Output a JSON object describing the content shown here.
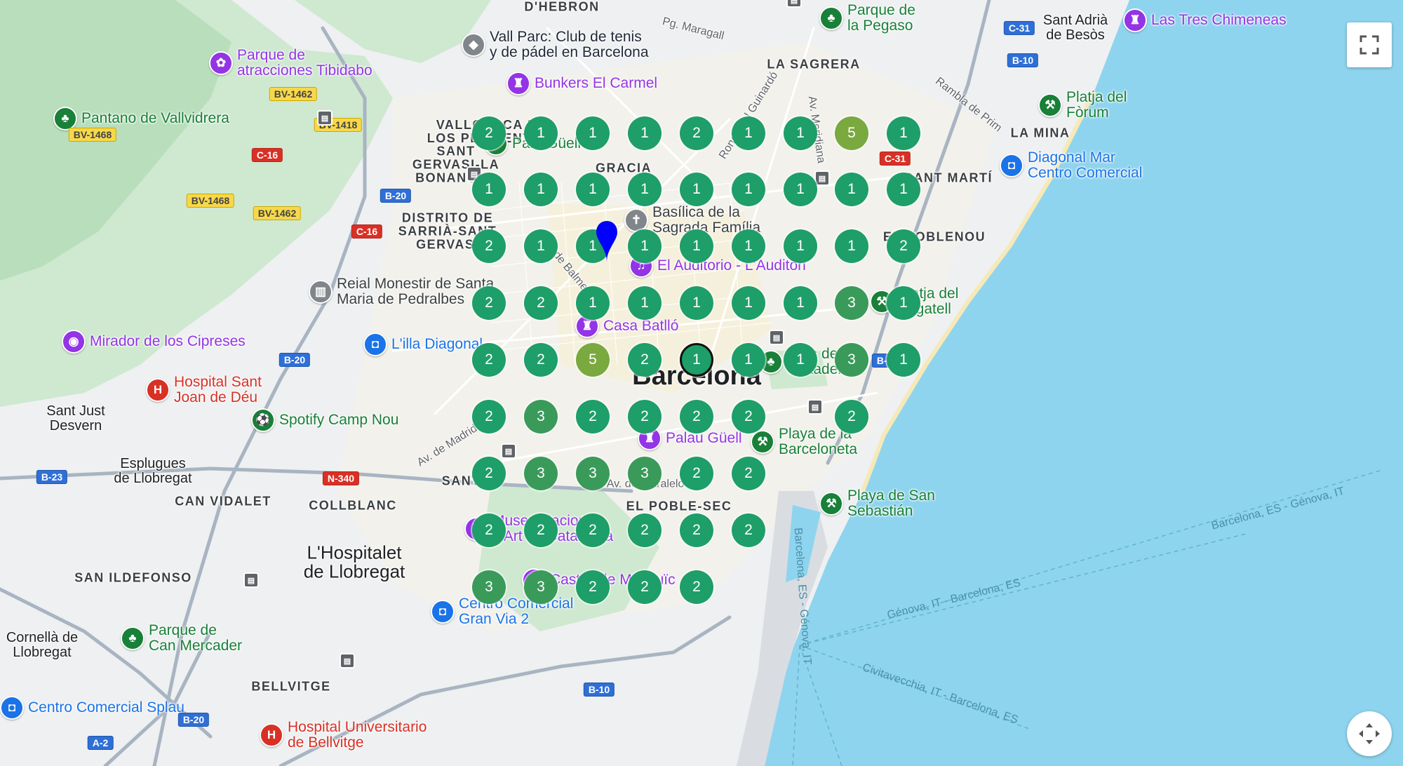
{
  "map": {
    "city_label": "Barcelona",
    "places": [
      {
        "id": "dhebron",
        "text": "D'HEBRON",
        "cls": "district"
      },
      {
        "id": "la-sagrera",
        "text": "LA SAGRERA",
        "cls": "district"
      },
      {
        "id": "la-mina",
        "text": "LA MINA",
        "cls": "district"
      },
      {
        "id": "gracia",
        "text": "GRACIA",
        "cls": "district"
      },
      {
        "id": "sant-marti",
        "text": "SANT MARTÍ",
        "cls": "district"
      },
      {
        "id": "sant-gervasi",
        "text": "SANT\nGERVASI-LA\nBONANOVA",
        "cls": "district"
      },
      {
        "id": "vallcarca",
        "text": "VALLCARCA I\nLOS PENITENTS",
        "cls": "district"
      },
      {
        "id": "sarria",
        "text": "DISTRITO DE\nSARRIÀ-SANT\nGERVASI",
        "cls": "district"
      },
      {
        "id": "el-poblenou",
        "text": "EL POBLENOU",
        "cls": "district"
      },
      {
        "id": "can-vidalet",
        "text": "CAN VIDALET",
        "cls": "district"
      },
      {
        "id": "collblanc",
        "text": "COLLBLANC",
        "cls": "district"
      },
      {
        "id": "el-poble-sec",
        "text": "EL POBLE-SEC",
        "cls": "district"
      },
      {
        "id": "san-ildefonso",
        "text": "SAN ILDEFONSO",
        "cls": "district"
      },
      {
        "id": "bellvitge",
        "text": "BELLVITGE",
        "cls": "district"
      },
      {
        "id": "sants",
        "text": "SANTS",
        "cls": "district"
      },
      {
        "id": "sant-adria",
        "text": "Sant Adrià\nde Besòs",
        "cls": "town"
      },
      {
        "id": "sant-just",
        "text": "Sant Just\nDesvern",
        "cls": "town"
      },
      {
        "id": "esplugues",
        "text": "Esplugues\nde Llobregat",
        "cls": "town"
      },
      {
        "id": "hospitalet",
        "text": "L'Hospitalet\nde Llobregat",
        "cls": "city"
      },
      {
        "id": "cornella",
        "text": "Cornellà de\nLlobregat",
        "cls": "town"
      },
      {
        "id": "pg-maragall",
        "text": "Pg. Maragall",
        "cls": "street"
      },
      {
        "id": "rambla-prim",
        "text": "Rambla de Prim",
        "cls": "street"
      },
      {
        "id": "ronda-guinardo",
        "text": "Ronda del Guinardó",
        "cls": "street"
      },
      {
        "id": "av-meridiana",
        "text": "Av. Meridiana",
        "cls": "street"
      },
      {
        "id": "av-madrid",
        "text": "Av. de Madrid",
        "cls": "street"
      },
      {
        "id": "de-balmes",
        "text": "de Balmes",
        "cls": "street"
      },
      {
        "id": "av-paralelo",
        "text": "Av. del Paralelo",
        "cls": "street"
      },
      {
        "id": "route-genova",
        "text": "Barcelona, ES - Génova, IT",
        "cls": "sea"
      },
      {
        "id": "route-genova-bcn",
        "text": "Génova, IT - Barcelona, ES",
        "cls": "sea"
      },
      {
        "id": "route-civita",
        "text": "Civitavecchia, IT - Barcelona, ES",
        "cls": "sea"
      },
      {
        "id": "route-bcn-genova-v",
        "text": "Barcelona, ES - Génova, IT",
        "cls": "sea"
      }
    ],
    "pois": [
      {
        "id": "vall-parc",
        "text": "Vall Parc: Club de tenis\ny de pádel en Barcelona",
        "color": "#1f2937",
        "pin": "#80868b",
        "glyph": "◆"
      },
      {
        "id": "parque-pegaso",
        "text": "Parque de\nla Pegaso",
        "color": "#188038",
        "pin": "#188038",
        "glyph": "♣"
      },
      {
        "id": "tres-chimeneas",
        "text": "Las Tres Chimeneas",
        "color": "#9334e6",
        "pin": "#9334e6",
        "glyph": "♜"
      },
      {
        "id": "tibidabo",
        "text": "Parque de\natracciones Tibidabo",
        "color": "#9334e6",
        "pin": "#9334e6",
        "glyph": "✿"
      },
      {
        "id": "bunkers",
        "text": "Bunkers El Carmel",
        "color": "#9334e6",
        "pin": "#9334e6",
        "glyph": "♜"
      },
      {
        "id": "platja-forum",
        "text": "Platja del\nFòrum",
        "color": "#188038",
        "pin": "#188038",
        "glyph": "⚒"
      },
      {
        "id": "pantano",
        "text": "Pantano de Vallvidrera",
        "color": "#188038",
        "pin": "#188038",
        "glyph": "♣"
      },
      {
        "id": "diagonal-mar",
        "text": "Diagonal Mar\nCentro Comercial",
        "color": "#1a73e8",
        "pin": "#1a73e8",
        "glyph": "◘"
      },
      {
        "id": "park-guell",
        "text": "Park Güell",
        "color": "#188038",
        "pin": "#188038",
        "glyph": "♣"
      },
      {
        "id": "sagrada",
        "text": "Basílica de la\nSagrada Família",
        "color": "#3c4043",
        "pin": "#80868b",
        "glyph": "✝"
      },
      {
        "id": "auditori",
        "text": "El Auditorio - L'Auditori",
        "color": "#9334e6",
        "pin": "#9334e6",
        "glyph": "♫"
      },
      {
        "id": "pedralbes",
        "text": "Reial Monestir de Santa\nMaria de Pedralbes",
        "color": "#3c4043",
        "pin": "#80868b",
        "glyph": "▥"
      },
      {
        "id": "cipreses",
        "text": "Mirador de los Cipreses",
        "color": "#9334e6",
        "pin": "#9334e6",
        "glyph": "◉"
      },
      {
        "id": "illa",
        "text": "L'illa Diagonal",
        "color": "#1a73e8",
        "pin": "#1a73e8",
        "glyph": "◘"
      },
      {
        "id": "casa-batllo",
        "text": "Casa Batlló",
        "color": "#9334e6",
        "pin": "#9334e6",
        "glyph": "♜"
      },
      {
        "id": "platja-bogatell",
        "text": "Platja del\nBogatell",
        "color": "#188038",
        "pin": "#188038",
        "glyph": "⚒"
      },
      {
        "id": "hospital-sjd",
        "text": "Hospital Sant\nJoan de Déu",
        "color": "#d93025",
        "pin": "#d93025",
        "glyph": "H"
      },
      {
        "id": "spotify",
        "text": "Spotify Camp Nou",
        "color": "#188038",
        "pin": "#188038",
        "glyph": "⚽"
      },
      {
        "id": "ciutadella",
        "text": "Parc de la\nCiutadella",
        "color": "#188038",
        "pin": "#188038",
        "glyph": "♣"
      },
      {
        "id": "palau-guell",
        "text": "Palau Güell",
        "color": "#9334e6",
        "pin": "#9334e6",
        "glyph": "♜"
      },
      {
        "id": "barceloneta",
        "text": "Playa de la\nBarceloneta",
        "color": "#188038",
        "pin": "#188038",
        "glyph": "⚒"
      },
      {
        "id": "san-sebastian",
        "text": "Playa de San\nSebastián",
        "color": "#188038",
        "pin": "#188038",
        "glyph": "⚒"
      },
      {
        "id": "mnac",
        "text": "Museu Nacional\nd'Art de Catalunya",
        "color": "#9334e6",
        "pin": "#9334e6",
        "glyph": "♜"
      },
      {
        "id": "castell",
        "text": "Castell de Montjuïc",
        "color": "#9334e6",
        "pin": "#9334e6",
        "glyph": "♜"
      },
      {
        "id": "gran-via-2",
        "text": "Centro Comercial\nGran Via 2",
        "color": "#1a73e8",
        "pin": "#1a73e8",
        "glyph": "◘"
      },
      {
        "id": "can-mercader",
        "text": "Parque de\nCan Mercader",
        "color": "#188038",
        "pin": "#188038",
        "glyph": "♣"
      },
      {
        "id": "splau",
        "text": "Centro Comercial Splau",
        "color": "#1a73e8",
        "pin": "#1a73e8",
        "glyph": "◘"
      },
      {
        "id": "hosp-bellvitge",
        "text": "Hospital Universitario\nde Bellvitge",
        "color": "#d93025",
        "pin": "#d93025",
        "glyph": "H"
      }
    ],
    "road_shields": [
      {
        "id": "bv-1462-a",
        "text": "BV-1462",
        "type": "yellow"
      },
      {
        "id": "bv-1418",
        "text": "BV-1418",
        "type": "yellow"
      },
      {
        "id": "bv-1468-a",
        "text": "BV-1468",
        "type": "yellow"
      },
      {
        "id": "bv-1468-b",
        "text": "BV-1468",
        "type": "yellow"
      },
      {
        "id": "bv-1462-b",
        "text": "BV-1462",
        "type": "yellow"
      },
      {
        "id": "c-16-a",
        "text": "C-16",
        "type": "red"
      },
      {
        "id": "c-16-b",
        "text": "C-16",
        "type": "red"
      },
      {
        "id": "b-20-a",
        "text": "B-20",
        "type": "blue"
      },
      {
        "id": "b-20-b",
        "text": "B-20",
        "type": "blue"
      },
      {
        "id": "b-20-c",
        "text": "B-20",
        "type": "blue"
      },
      {
        "id": "c-31-a",
        "text": "C-31",
        "type": "blue"
      },
      {
        "id": "c-31-b",
        "text": "C-31",
        "type": "red"
      },
      {
        "id": "b-10-a",
        "text": "B-10",
        "type": "blue"
      },
      {
        "id": "b-10-b",
        "text": "B-10",
        "type": "blue"
      },
      {
        "id": "b-10-c",
        "text": "B-10",
        "type": "blue"
      },
      {
        "id": "b-23",
        "text": "B-23",
        "type": "blue"
      },
      {
        "id": "n-340",
        "text": "N-340",
        "type": "red"
      },
      {
        "id": "a-2",
        "text": "A-2",
        "type": "blue"
      }
    ],
    "cluster_colors": {
      "small": "#1e9e68",
      "medium": "#3a9a5a",
      "large": "#79a93f"
    },
    "clusters": [
      [
        2,
        1,
        1,
        1,
        2,
        1,
        1,
        5,
        1
      ],
      [
        1,
        1,
        1,
        1,
        1,
        1,
        1,
        1,
        1
      ],
      [
        2,
        1,
        1,
        1,
        1,
        1,
        1,
        1,
        2
      ],
      [
        2,
        2,
        1,
        1,
        1,
        1,
        1,
        3,
        1
      ],
      [
        2,
        2,
        5,
        2,
        1,
        1,
        1,
        3,
        1
      ],
      [
        2,
        3,
        2,
        2,
        2,
        2,
        null,
        2,
        null
      ],
      [
        2,
        3,
        3,
        3,
        2,
        2,
        null,
        null,
        null
      ],
      [
        2,
        2,
        2,
        2,
        2,
        2,
        null,
        null,
        null
      ],
      [
        3,
        3,
        2,
        2,
        2,
        null,
        null,
        null,
        null
      ]
    ],
    "selected_cluster": "4-4",
    "marker_color": "#0000ff"
  },
  "controls": {
    "fullscreen_icon": "fullscreen-icon",
    "camera_icon": "camera-control-icon"
  }
}
